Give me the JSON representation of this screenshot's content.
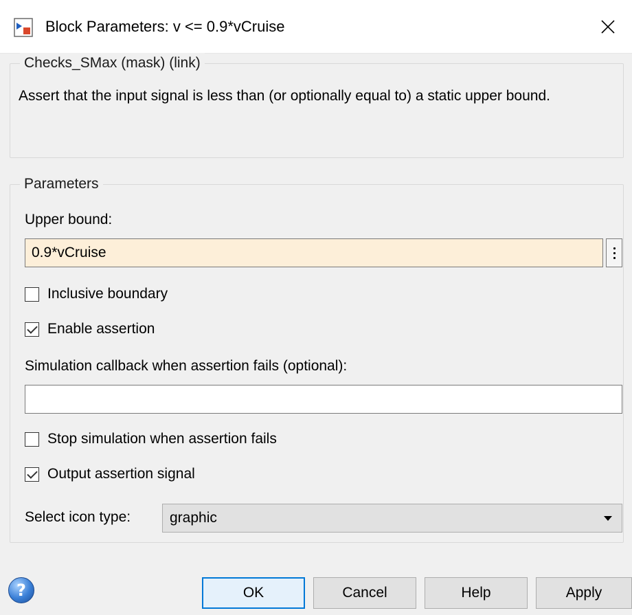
{
  "window": {
    "title": "Block Parameters: v <= 0.9*vCruise",
    "icon": "simulink-block-icon",
    "close_icon": "close-icon"
  },
  "description": {
    "group_title": "Checks_SMax (mask) (link)",
    "text": "Assert that the input signal is less than (or optionally equal to) a static upper bound."
  },
  "parameters": {
    "group_title": "Parameters",
    "upper_bound": {
      "label": "Upper bound:",
      "value": "0.9*vCruise"
    },
    "inclusive_boundary": {
      "label": "Inclusive boundary",
      "checked": false
    },
    "enable_assertion": {
      "label": "Enable assertion",
      "checked": true
    },
    "callback": {
      "label": "Simulation callback when assertion fails (optional):",
      "value": ""
    },
    "stop_simulation": {
      "label": "Stop simulation when assertion fails",
      "checked": false
    },
    "output_assertion_signal": {
      "label": "Output assertion signal",
      "checked": true
    },
    "icon_type": {
      "label": "Select icon type:",
      "selected": "graphic"
    }
  },
  "buttons": {
    "ok": "OK",
    "cancel": "Cancel",
    "help": "Help",
    "apply": "Apply"
  },
  "colors": {
    "highlight_input": "#fdefd9",
    "default_button_border": "#0078d7"
  }
}
